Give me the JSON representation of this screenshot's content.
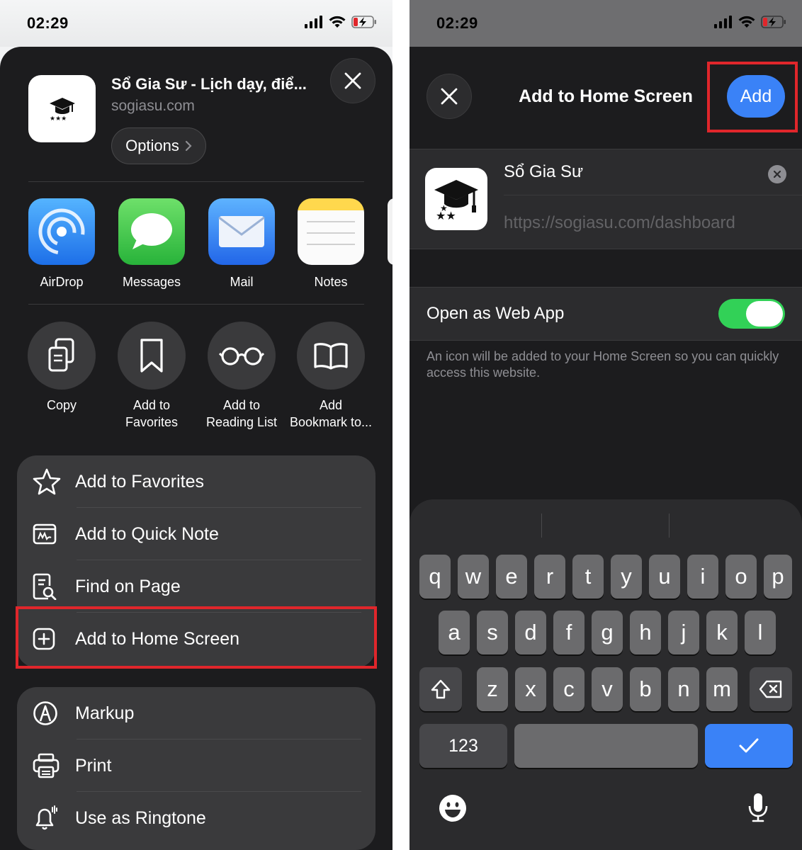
{
  "status": {
    "time": "02:29"
  },
  "left": {
    "site": {
      "title": "Sổ Gia Sư - Lịch dạy, điể...",
      "url": "sogiasu.com",
      "options_label": "Options"
    },
    "share_apps": [
      {
        "label": "AirDrop"
      },
      {
        "label": "Messages"
      },
      {
        "label": "Mail"
      },
      {
        "label": "Notes"
      }
    ],
    "actions": [
      {
        "line1": "Copy",
        "line2": ""
      },
      {
        "line1": "Add to",
        "line2": "Favorites"
      },
      {
        "line1": "Add to",
        "line2": "Reading List"
      },
      {
        "line1": "Add",
        "line2": "Bookmark to..."
      }
    ],
    "menu_group1": [
      "Add to Favorites",
      "Add to Quick Note",
      "Find on Page",
      "Add to Home Screen"
    ],
    "menu_group2": [
      "Markup",
      "Print",
      "Use as Ringtone"
    ]
  },
  "right": {
    "title": "Add to Home Screen",
    "add_label": "Add",
    "name_value": "Sổ Gia Sư",
    "url_value": "https://sogiasu.com/dashboard",
    "web_app_label": "Open as Web App",
    "web_app_enabled": true,
    "description": "An icon will be added to your Home Screen so you can quickly access this website.",
    "keyboard": {
      "row1": [
        "q",
        "w",
        "e",
        "r",
        "t",
        "y",
        "u",
        "i",
        "o",
        "p"
      ],
      "row2": [
        "a",
        "s",
        "d",
        "f",
        "g",
        "h",
        "j",
        "k",
        "l"
      ],
      "row3": [
        "z",
        "x",
        "c",
        "v",
        "b",
        "n",
        "m"
      ],
      "numbers_label": "123"
    }
  },
  "colors": {
    "highlight": "#e0262b",
    "accent_blue": "#3a82f7",
    "toggle_green": "#32d157"
  }
}
